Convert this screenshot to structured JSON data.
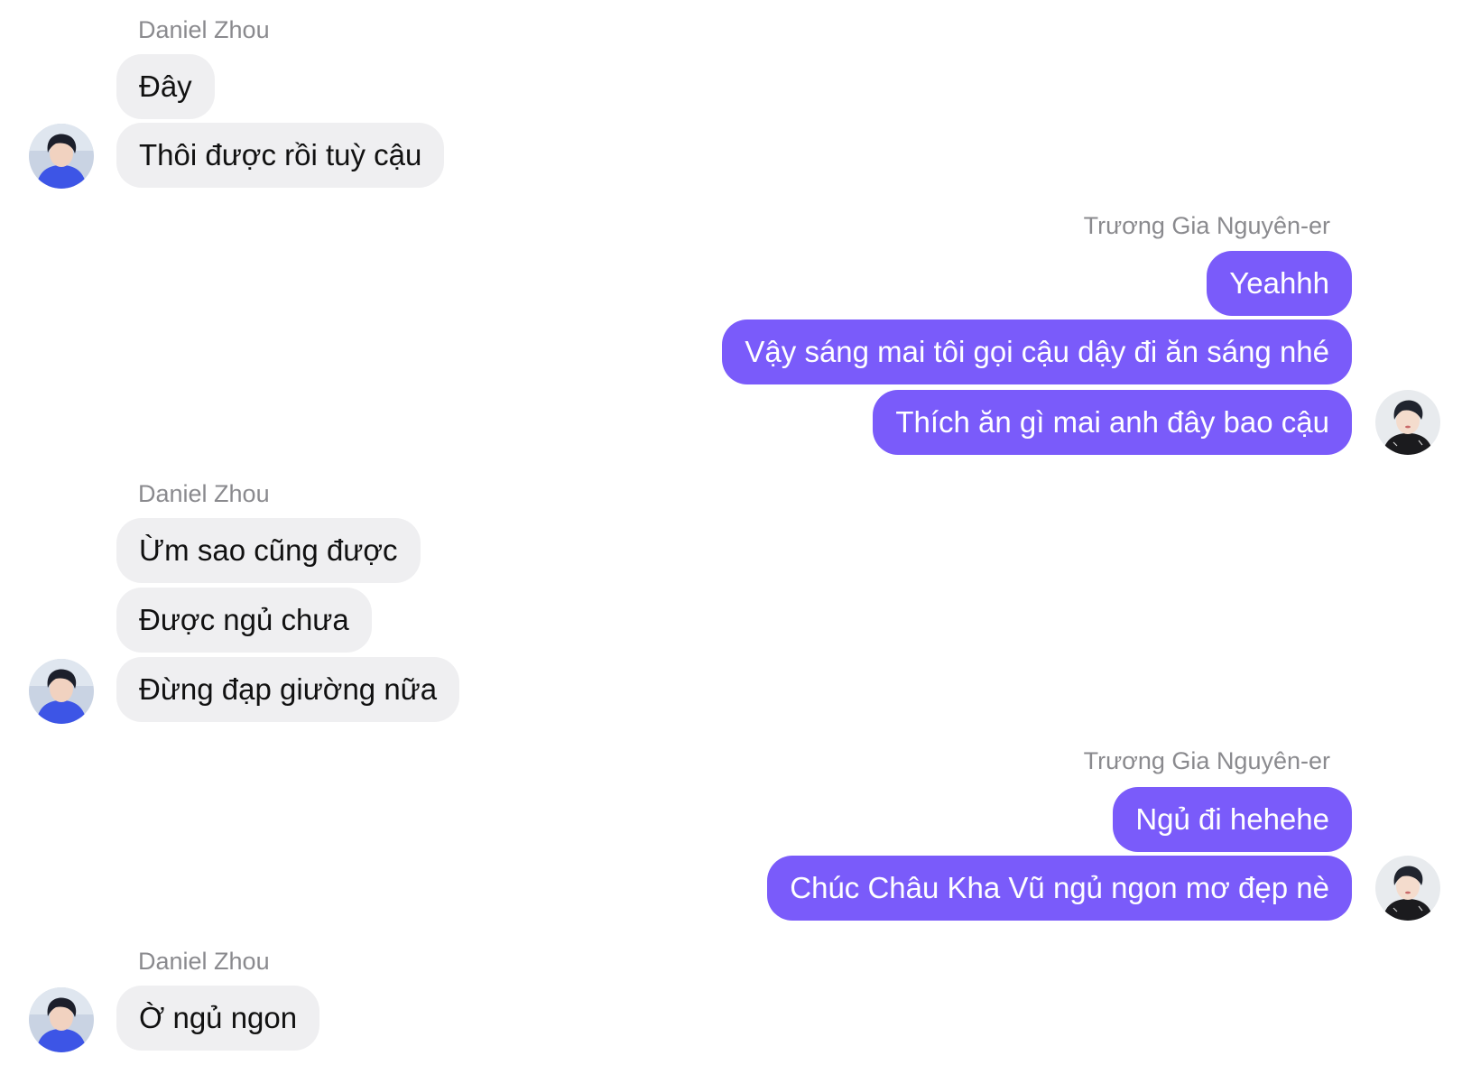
{
  "contacts": {
    "other": "Daniel Zhou",
    "me": "Trương Gia Nguyên-er"
  },
  "colors": {
    "incoming_bubble": "#efeff1",
    "outgoing_bubble": "#7a5bfa",
    "sender_name": "#8a8a8e"
  },
  "messages": {
    "g1": [
      "Đây",
      "Thôi được rồi tuỳ cậu"
    ],
    "g2": [
      "Yeahhh",
      "Vậy sáng mai tôi gọi cậu dậy đi ăn sáng nhé",
      "Thích ăn gì mai anh đây bao cậu"
    ],
    "g3": [
      "Ừm sao cũng được",
      "Được ngủ chưa",
      "Đừng đạp giường nữa"
    ],
    "g4": [
      "Ngủ đi hehehe",
      "Chúc Châu Kha Vũ ngủ ngon mơ đẹp nè"
    ],
    "g5": [
      "Ờ ngủ ngon"
    ]
  }
}
